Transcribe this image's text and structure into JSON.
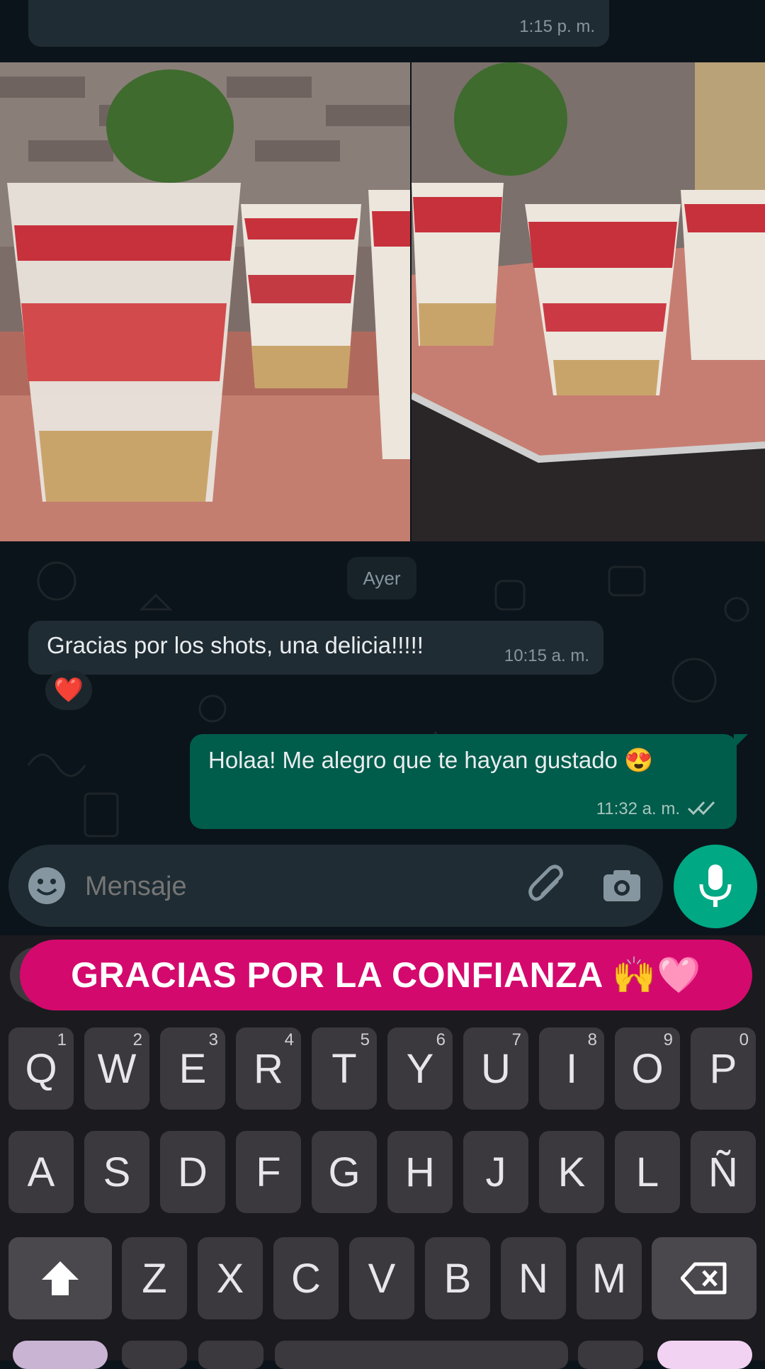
{
  "chat": {
    "top_bubble_time": "1:15 p. m.",
    "day_separator": "Ayer",
    "incoming": {
      "text": "Gracias por los shots, una delicia!!!!!",
      "time": "10:15 a. m.",
      "reaction": "❤️"
    },
    "outgoing": {
      "text": "Holaa! Me alegro que te hayan gustado 😍",
      "time": "11:32 a. m."
    },
    "photo_icons": [
      "photo-left",
      "photo-right"
    ]
  },
  "composer": {
    "placeholder": "Mensaje",
    "icons": [
      "emoji-icon",
      "attach-icon",
      "camera-icon",
      "mic-icon"
    ]
  },
  "keyboard": {
    "suggestion": "GRACIAS POR LA CONFIANZA 🙌🩷",
    "row1": [
      {
        "k": "Q",
        "h": "1"
      },
      {
        "k": "W",
        "h": "2"
      },
      {
        "k": "E",
        "h": "3"
      },
      {
        "k": "R",
        "h": "4"
      },
      {
        "k": "T",
        "h": "5"
      },
      {
        "k": "Y",
        "h": "6"
      },
      {
        "k": "U",
        "h": "7"
      },
      {
        "k": "I",
        "h": "8"
      },
      {
        "k": "O",
        "h": "9"
      },
      {
        "k": "P",
        "h": "0"
      }
    ],
    "row2": [
      "A",
      "S",
      "D",
      "F",
      "G",
      "H",
      "J",
      "K",
      "L",
      "Ñ"
    ],
    "row3": [
      "Z",
      "X",
      "C",
      "V",
      "B",
      "N",
      "M"
    ]
  },
  "colors": {
    "chat_bg": "#0b141a",
    "incoming_bubble": "#202c33",
    "outgoing_bubble": "#005c4b",
    "accent_green": "#00a884",
    "suggestion_pink": "#d4096d",
    "keyboard_bg": "#1b1a1e"
  }
}
